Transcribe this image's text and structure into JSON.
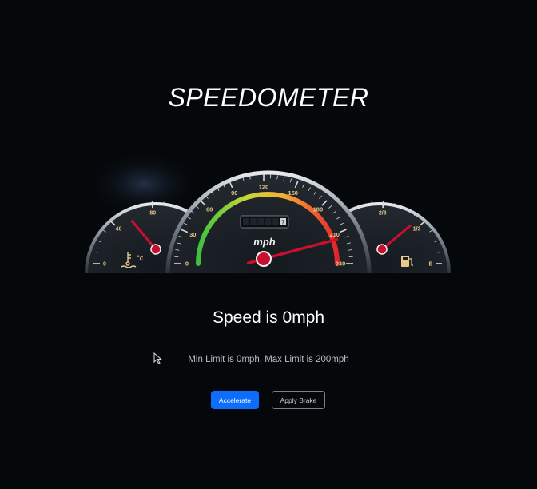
{
  "page": {
    "title": "SPEEDOMETER"
  },
  "dashboard": {
    "speed_gauge": {
      "unit": "mph",
      "ticks": [
        "0",
        "30",
        "60",
        "90",
        "120",
        "150",
        "180",
        "210",
        "240"
      ],
      "odometer": [
        "",
        "",
        "",
        "",
        "",
        "7"
      ],
      "needle_value": 220,
      "min": 0,
      "max": 240
    },
    "temp_gauge": {
      "ticks": [
        "0",
        "40",
        "80",
        "120"
      ],
      "unit_label": "°c",
      "needle_value": 20
    },
    "fuel_gauge": {
      "ticks": [
        "F",
        "2/3",
        "1/3",
        "E"
      ],
      "needle_level": 0.15
    }
  },
  "status": {
    "speed_text": "Speed is 0mph",
    "limits_text": "Min Limit is 0mph, Max Limit is 200mph"
  },
  "controls": {
    "accelerate_label": "Accelerate",
    "brake_label": "Apply Brake"
  },
  "colors": {
    "background": "#05080b",
    "needle": "#c8102e",
    "primary_button": "#0d6efd",
    "tick_label": "#e8c98a"
  }
}
